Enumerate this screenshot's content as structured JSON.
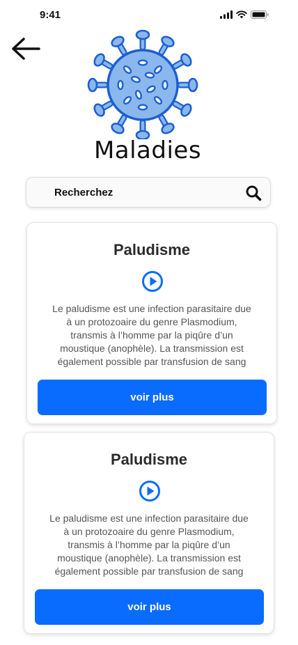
{
  "status_bar": {
    "time": "9:41",
    "icons": [
      "signal-icon",
      "wifi-icon",
      "battery-icon"
    ]
  },
  "header": {
    "back_icon": "back-arrow-icon",
    "logo_icon": "virus-icon",
    "title": "Maladies"
  },
  "search": {
    "placeholder": "Recherchez",
    "value": "",
    "icon": "search-icon"
  },
  "colors": {
    "accent": "#0a6cff",
    "virus_fill": "#8ab8ee",
    "virus_stroke": "#1d5fd1",
    "text_dark": "#2b2b2b"
  },
  "cards": [
    {
      "title": "Paludisme",
      "play_icon": "play-circle-icon",
      "description_lines": [
        "Le paludisme est une infection parasitaire due",
        "à un protozoaire du genre Plasmodium,",
        "transmis à l’homme par la piqûre d’un",
        "moustique (anophèle). La transmission est",
        "également possible par transfusion de sang"
      ],
      "button_label": "voir plus"
    },
    {
      "title": "Paludisme",
      "play_icon": "play-circle-icon",
      "description_lines": [
        "Le paludisme est une infection parasitaire due",
        "à un protozoaire du genre Plasmodium,",
        "transmis à l’homme par la piqûre d’un",
        "moustique (anophèle). La transmission est",
        "également possible par transfusion de sang"
      ],
      "button_label": "voir plus"
    }
  ]
}
